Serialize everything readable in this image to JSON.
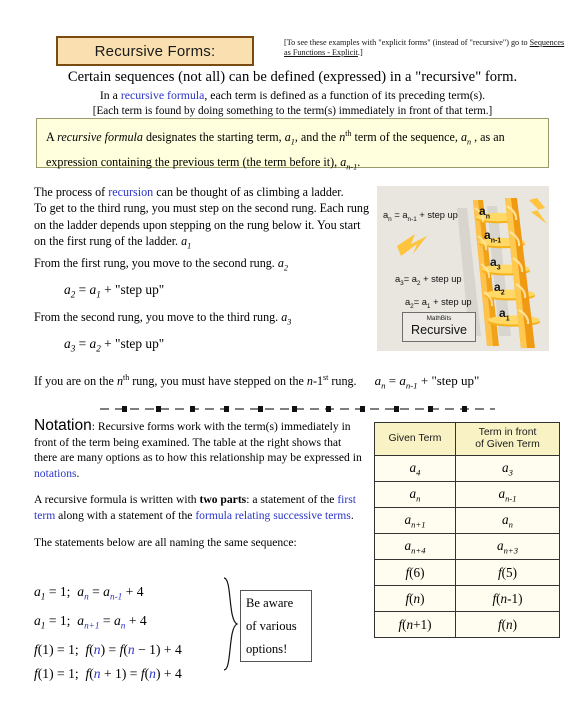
{
  "header": {
    "title": "Recursive Forms:",
    "explicit_note_part1": "[To see these examples with \"explicit forms\" (instead of \"recursive\") go to ",
    "explicit_note_link": "Sequences as Functions - Explicit",
    "explicit_note_part2": ".]"
  },
  "intro": {
    "line1": "Certain sequences (not all) can be defined (expressed) in a \"recursive\" form.",
    "line2_pre": "In a ",
    "line2_link": "recursive formula",
    "line2_post": ", each term is defined as a function of its preceding term(s).",
    "line3": "[Each term is found by doing something to the term(s) immediately in front of that term.]"
  },
  "callout": {
    "s1": "A ",
    "s2_italic": "recursive formula",
    "s3": " designates the starting term, ",
    "a1": "a1",
    "s4": ", and the ",
    "nth": "nth",
    "s5": " term of the sequence, ",
    "an": "an",
    "s6": " , as an expression containing the previous term (the term before it), ",
    "an1": "an-1",
    "s7": "."
  },
  "ladder_text": {
    "p1_pre": "The process of ",
    "p1_link": "recursion",
    "p1_post": " can be thought of as climbing a ladder.",
    "p2": "To get to the third rung, you must step on the second rung. Each rung on the ladder depends upon stepping on the rung below it. You start on the first rung of the ladder. ",
    "p2_term": "a1",
    "p3": "From the first rung, you move to the second rung. ",
    "p3_term": "a2",
    "eq1": "a2 = a1 + \"step up\"",
    "p4": "From the second rung, you move to the third rung. ",
    "p4_term": "a3",
    "eq2": "a3 = a2 + \"step up\"",
    "p5_a": "If you are on the ",
    "p5_nth": "nth",
    "p5_b": " rung, you must have stepped on the ",
    "p5_n1st": "n-1st",
    "p5_c": " rung.",
    "p5_eq": "an = an-1 + \"step up\""
  },
  "ladder_image": {
    "label_top": "an = an-1 + step up",
    "label_mid": "a3 = a2 + step up",
    "label_low": "a2 = a1 + step up",
    "rung_labels": [
      "an",
      "an-1",
      "a3",
      "a2",
      "a1"
    ],
    "watermark_small": "MathBits",
    "watermark_big": "Recursive",
    "bg_color": "#e9e5df",
    "ladder_color": "#f5a623",
    "ladder_color_light": "#ffd24d"
  },
  "notation": {
    "heading": "Notation",
    "p1_after_heading": ": Recursive forms work with the term(s) immediately in front of the term being examined. The table at the right shows that there are many options as to how this relationship may be expressed in ",
    "p1_link": "notations",
    "p1_end": ".",
    "p2_a": "A recursive formula is written with ",
    "p2_bold": "two parts",
    "p2_b": ": a statement of the ",
    "p2_link1": "first term",
    "p2_c": " along with a statement of the ",
    "p2_link2": "formula relating successive terms",
    "p2_d": ".",
    "p3": "The statements below are all naming the same sequence:"
  },
  "equations": [
    "a1 = 1;  an = an-1 + 4",
    "a1 = 1;  an+1 = an + 4",
    "f(1) = 1;  f(n) = f(n - 1) + 4",
    "f(1) = 1;  f(n + 1) = f(n) + 4"
  ],
  "aware_box": {
    "line1": "Be aware",
    "line2": "of various",
    "line3": "options!"
  },
  "table": {
    "headers": [
      "Given Term",
      "Term in front of Given Term"
    ],
    "header1": "Given Term",
    "header2_line1": "Term in front",
    "header2_line2": "of Given Term",
    "rows": [
      {
        "given": "a4",
        "front": "a3"
      },
      {
        "given": "an",
        "front": "an-1"
      },
      {
        "given": "an+1",
        "front": "an"
      },
      {
        "given": "an+4",
        "front": "an+3"
      },
      {
        "given": "f(6)",
        "front": "f(5)"
      },
      {
        "given": "f(n)",
        "front": "f(n-1)"
      },
      {
        "given": "f(n+1)",
        "front": "f(n)"
      }
    ]
  },
  "colors": {
    "title_bg": "#fae0b0",
    "title_border": "#7a4a10",
    "callout_bg": "#ffffdd",
    "link_blue": "#2b35c8",
    "table_header_bg": "#f8f2c4",
    "table_cell_bg": "#fffdf0"
  }
}
